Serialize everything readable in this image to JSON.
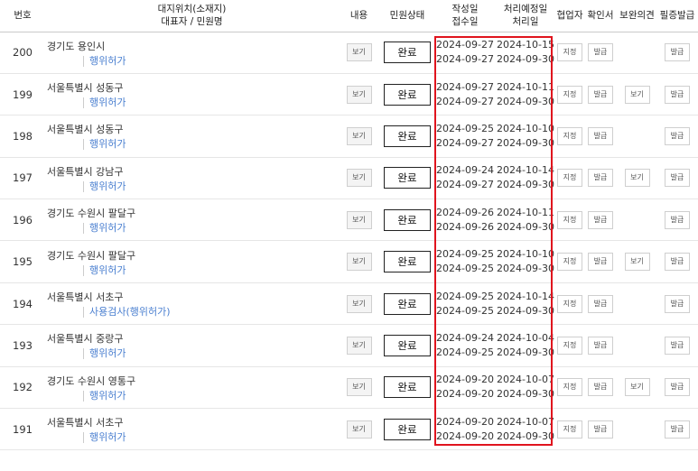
{
  "header": {
    "col_num": "번호",
    "col_location": "대지위치(소재지)",
    "col_location_sub": "대표자 / 민원명",
    "col_content": "내용",
    "col_status": "민원상태",
    "col_written": "작성일",
    "col_received": "접수일",
    "col_due": "처리예정일",
    "col_processed": "처리일",
    "col_partner": "협업자",
    "col_confirm": "확인서",
    "col_supplement": "보완의견",
    "col_certificate": "필증발급"
  },
  "rows": [
    {
      "num": "200",
      "location": "경기도 용인시",
      "permit": "행위허가",
      "view": "보기",
      "status": "완료",
      "written": "2024-09-27",
      "received": "2024-09-27",
      "due": "2024-10-15",
      "processed": "2024-09-30",
      "partner": "지정",
      "confirm": "발급",
      "supplement": "",
      "certificate": "발급"
    },
    {
      "num": "199",
      "location": "서울특별시 성동구",
      "permit": "행위허가",
      "view": "보기",
      "status": "완료",
      "written": "2024-09-27",
      "received": "2024-09-27",
      "due": "2024-10-11",
      "processed": "2024-09-30",
      "partner": "지정",
      "confirm": "발급",
      "supplement": "보기",
      "certificate": "발급"
    },
    {
      "num": "198",
      "location": "서울특별시 성동구",
      "permit": "행위허가",
      "view": "보기",
      "status": "완료",
      "written": "2024-09-25",
      "received": "2024-09-27",
      "due": "2024-10-10",
      "processed": "2024-09-30",
      "partner": "지정",
      "confirm": "발급",
      "supplement": "",
      "certificate": "발급"
    },
    {
      "num": "197",
      "location": "서울특별시 강남구",
      "permit": "행위허가",
      "view": "보기",
      "status": "완료",
      "written": "2024-09-24",
      "received": "2024-09-27",
      "due": "2024-10-14",
      "processed": "2024-09-30",
      "partner": "지정",
      "confirm": "발급",
      "supplement": "보기",
      "certificate": "발급"
    },
    {
      "num": "196",
      "location": "경기도 수원시 팔달구",
      "permit": "행위허가",
      "view": "보기",
      "status": "완료",
      "written": "2024-09-26",
      "received": "2024-09-26",
      "due": "2024-10-11",
      "processed": "2024-09-30",
      "partner": "지정",
      "confirm": "발급",
      "supplement": "",
      "certificate": "발급"
    },
    {
      "num": "195",
      "location": "경기도 수원시 팔달구",
      "permit": "행위허가",
      "view": "보기",
      "status": "완료",
      "written": "2024-09-25",
      "received": "2024-09-25",
      "due": "2024-10-10",
      "processed": "2024-09-30",
      "partner": "지정",
      "confirm": "발급",
      "supplement": "보기",
      "certificate": "발급"
    },
    {
      "num": "194",
      "location": "서울특별시 서초구",
      "permit": "사용검사(행위허가)",
      "view": "보기",
      "status": "완료",
      "written": "2024-09-25",
      "received": "2024-09-25",
      "due": "2024-10-14",
      "processed": "2024-09-30",
      "partner": "지정",
      "confirm": "발급",
      "supplement": "",
      "certificate": "발급"
    },
    {
      "num": "193",
      "location": "서울특별시 중랑구",
      "permit": "행위허가",
      "view": "보기",
      "status": "완료",
      "written": "2024-09-24",
      "received": "2024-09-25",
      "due": "2024-10-04",
      "processed": "2024-09-30",
      "partner": "지정",
      "confirm": "발급",
      "supplement": "",
      "certificate": "발급"
    },
    {
      "num": "192",
      "location": "경기도 수원시 영통구",
      "permit": "행위허가",
      "view": "보기",
      "status": "완료",
      "written": "2024-09-20",
      "received": "2024-09-20",
      "due": "2024-10-07",
      "processed": "2024-09-30",
      "partner": "지정",
      "confirm": "발급",
      "supplement": "보기",
      "certificate": "발급"
    },
    {
      "num": "191",
      "location": "서울특별시 서초구",
      "permit": "행위허가",
      "view": "보기",
      "status": "완료",
      "written": "2024-09-20",
      "received": "2024-09-20",
      "due": "2024-10-07",
      "processed": "2024-09-30",
      "partner": "지정",
      "confirm": "발급",
      "supplement": "",
      "certificate": "발급"
    }
  ],
  "colors": {
    "highlight": "#e0141e",
    "link": "#4a7fd0"
  }
}
